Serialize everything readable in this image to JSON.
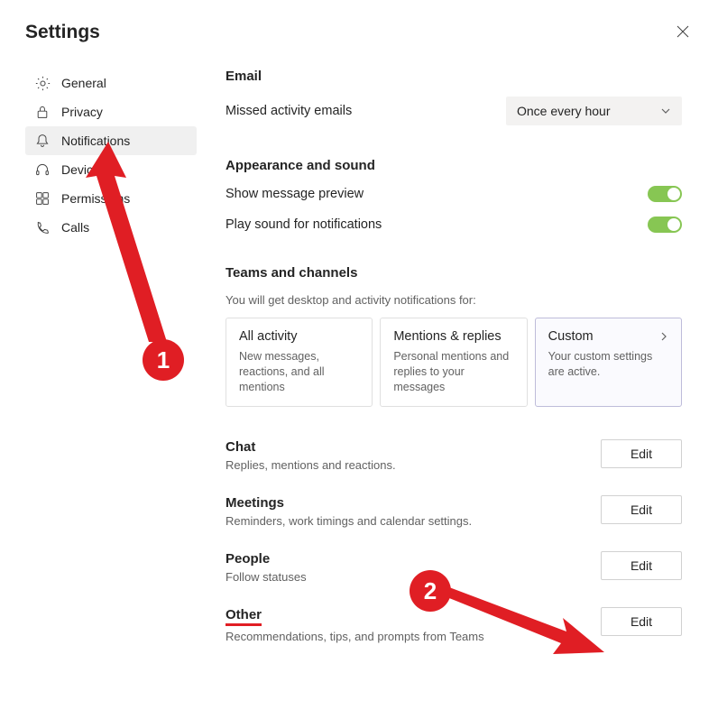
{
  "title": "Settings",
  "sidebar": {
    "items": [
      {
        "label": "General"
      },
      {
        "label": "Privacy"
      },
      {
        "label": "Notifications"
      },
      {
        "label": "Devices"
      },
      {
        "label": "Permissions"
      },
      {
        "label": "Calls"
      }
    ]
  },
  "email": {
    "heading": "Email",
    "row_label": "Missed activity emails",
    "dropdown_value": "Once every hour"
  },
  "appearance": {
    "heading": "Appearance and sound",
    "preview_label": "Show message preview",
    "sound_label": "Play sound for notifications"
  },
  "teams": {
    "heading": "Teams and channels",
    "sub": "You will get desktop and activity notifications for:",
    "cards": [
      {
        "title": "All activity",
        "desc": "New messages, reactions, and all mentions"
      },
      {
        "title": "Mentions & replies",
        "desc": "Personal mentions and replies to your messages"
      },
      {
        "title": "Custom",
        "desc": "Your custom settings are active."
      }
    ]
  },
  "sections": [
    {
      "title": "Chat",
      "desc": "Replies, mentions and reactions.",
      "btn": "Edit"
    },
    {
      "title": "Meetings",
      "desc": "Reminders, work timings and calendar settings.",
      "btn": "Edit"
    },
    {
      "title": "People",
      "desc": "Follow statuses",
      "btn": "Edit"
    },
    {
      "title": "Other",
      "desc": "Recommendations, tips, and prompts from Teams",
      "btn": "Edit"
    }
  ],
  "annotations": {
    "badge1": "1",
    "badge2": "2"
  }
}
